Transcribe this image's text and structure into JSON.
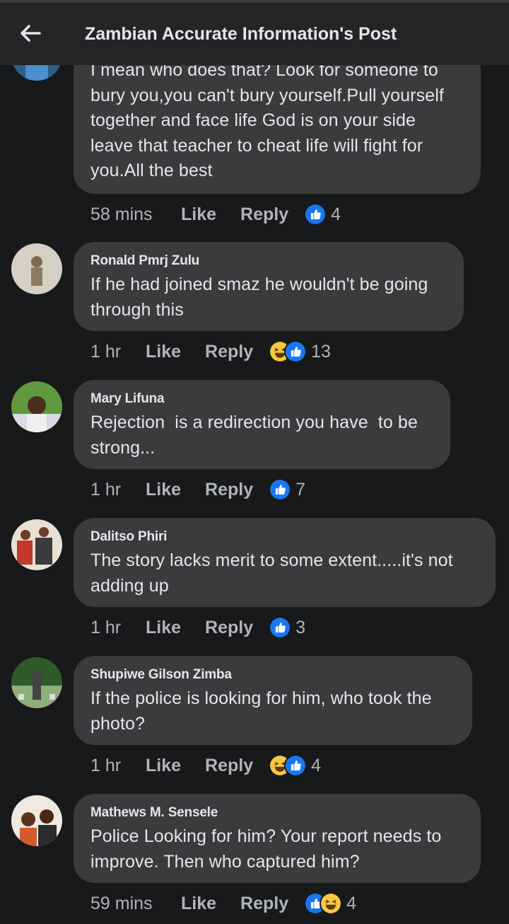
{
  "header": {
    "title": "Zambian Accurate Information's Post"
  },
  "comments": [
    {
      "author": "",
      "lines": [
        "I mean who does that? Look for someone to",
        "bury you,you can't bury yourself.Pull yourself",
        "together and face life God is on your side",
        "leave that teacher to cheat life will fight for",
        "you.All the best"
      ],
      "time": "58 mins",
      "like": "Like",
      "reply": "Reply",
      "reactions": [
        "like"
      ],
      "count": "4"
    },
    {
      "author": "Ronald Pmrj Zulu",
      "lines": [
        "If he had joined smaz he wouldn't be going",
        "through this"
      ],
      "time": "1 hr",
      "like": "Like",
      "reply": "Reply",
      "reactions": [
        "haha",
        "like"
      ],
      "count": "13"
    },
    {
      "author": "Mary Lifuna",
      "lines": [
        "Rejection  is a redirection you have  to be",
        "strong..."
      ],
      "time": "1 hr",
      "like": "Like",
      "reply": "Reply",
      "reactions": [
        "like"
      ],
      "count": "7"
    },
    {
      "author": "Dalitso Phiri",
      "lines": [
        "The story lacks merit to some extent.....it's not",
        "adding up"
      ],
      "time": "1 hr",
      "like": "Like",
      "reply": "Reply",
      "reactions": [
        "like"
      ],
      "count": "3"
    },
    {
      "author": "Shupiwe Gilson Zimba",
      "lines": [
        "If the police is looking for him, who took the",
        "photo?"
      ],
      "time": "1 hr",
      "like": "Like",
      "reply": "Reply",
      "reactions": [
        "haha",
        "like"
      ],
      "count": "4"
    },
    {
      "author": "Mathews M. Sensele",
      "lines": [
        "Police Looking for him? Your report needs to",
        "improve. Then who captured him?"
      ],
      "time": "59 mins",
      "like": "Like",
      "reply": "Reply",
      "reactions": [
        "like",
        "haha"
      ],
      "count": "4"
    }
  ],
  "colors": {
    "like_blue": "#1877f2",
    "haha_yellow": "#f7c843",
    "bubble": "#3a3b3c",
    "background": "#18191a"
  }
}
